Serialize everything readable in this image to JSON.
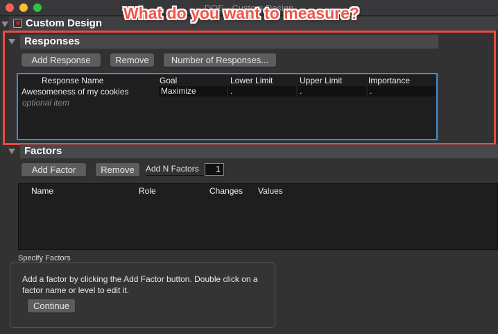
{
  "window": {
    "title": "DOE - Custom Design"
  },
  "annotation": "What do you want to measure?",
  "outline": {
    "title": "Custom Design"
  },
  "responses": {
    "title": "Responses",
    "buttons": {
      "add": "Add Response",
      "remove": "Remove",
      "number": "Number of Responses..."
    },
    "columns": [
      "Response Name",
      "Goal",
      "Lower Limit",
      "Upper Limit",
      "Importance"
    ],
    "rows": [
      {
        "name": "Awesomeness of my cookies",
        "goal": "Maximize",
        "lower": ".",
        "upper": ".",
        "importance": "."
      }
    ],
    "placeholder": "optional item"
  },
  "factors": {
    "title": "Factors",
    "buttons": {
      "add": "Add Factor",
      "remove": "Remove"
    },
    "add_n_label": "Add N Factors",
    "add_n_value": "1",
    "columns": [
      "Name",
      "Role",
      "Changes",
      "Values"
    ]
  },
  "specify": {
    "label": "Specify Factors",
    "text1": "Add a factor by clicking the Add Factor button. Double click on a",
    "text2": "factor name or level to edit it.",
    "continue": "Continue"
  }
}
